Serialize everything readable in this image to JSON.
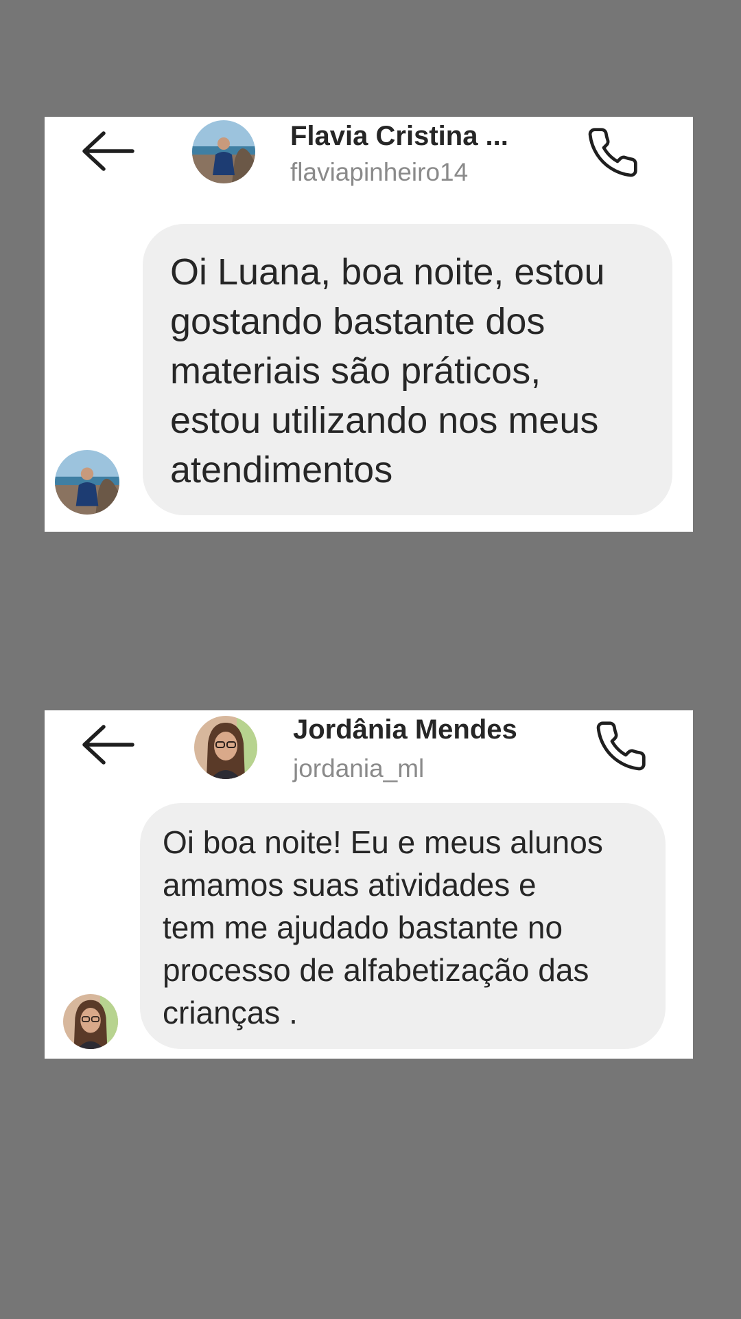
{
  "conversations": [
    {
      "name": "Flavia Cristina ...",
      "username": "flaviapinheiro14",
      "message": "Oi Luana, boa noite, estou\ngostando bastante dos\nmateriais  são práticos,\nestou utilizando nos meus\natendimentos"
    },
    {
      "name": "Jordânia Mendes",
      "username": "jordania_ml",
      "message": "Oi boa noite! Eu e meus alunos\namamos suas atividades e\ntem me ajudado bastante no\nprocesso de alfabetização das\ncrianças ."
    }
  ],
  "icons": {
    "back": "arrow-left-icon",
    "call": "phone-icon"
  },
  "colors": {
    "background": "#767676",
    "card": "#ffffff",
    "bubble": "#efefef",
    "text": "#262626",
    "username": "#8a8a8a"
  }
}
